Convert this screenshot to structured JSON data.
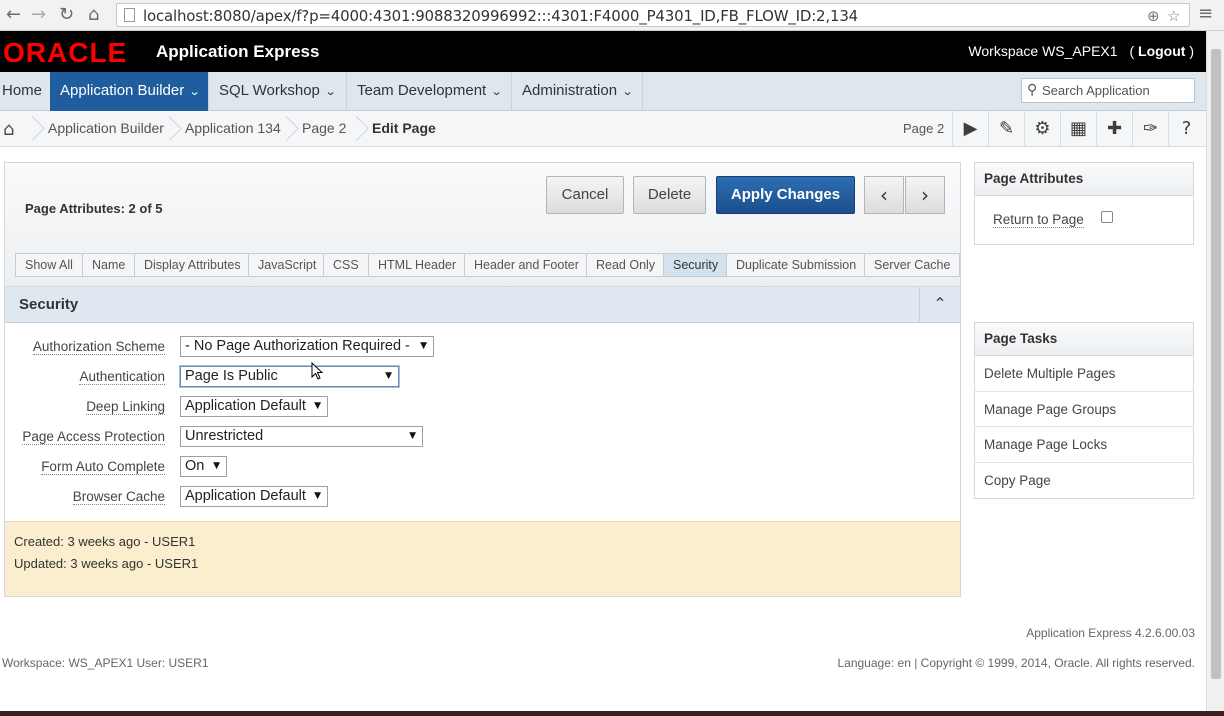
{
  "browser": {
    "url": "localhost:8080/apex/f?p=4000:4301:9088320996992:::4301:F4000_P4301_ID,FB_FLOW_ID:2,134"
  },
  "header": {
    "logo": "ORACLE",
    "product": "Application Express",
    "workspace_label": "Workspace WS_APEX1",
    "logout_open": "(",
    "logout": "Logout",
    "logout_close": ")"
  },
  "menu": {
    "items": [
      {
        "label": "Home"
      },
      {
        "label": "Application Builder"
      },
      {
        "label": "SQL Workshop"
      },
      {
        "label": "Team Development"
      },
      {
        "label": "Administration"
      }
    ],
    "search_placeholder": "Search Application"
  },
  "breadcrumb": {
    "items": [
      "Application Builder",
      "Application 134",
      "Page 2",
      "Edit Page"
    ],
    "page_indicator": "Page 2"
  },
  "region": {
    "title_label": "Page Attributes:",
    "title_count": "2 of 5",
    "buttons": {
      "cancel": "Cancel",
      "delete": "Delete",
      "apply": "Apply Changes"
    },
    "tabs": [
      "Show All",
      "Name",
      "Display Attributes",
      "JavaScript",
      "CSS",
      "HTML Header",
      "Header and Footer",
      "Read Only",
      "Security",
      "Duplicate Submission",
      "Server Cache"
    ],
    "active_tab": "Security",
    "section_title": "Security",
    "fields": [
      {
        "label": "Authorization Scheme",
        "value": "- No Page Authorization Required -"
      },
      {
        "label": "Authentication",
        "value": "Page Is Public"
      },
      {
        "label": "Deep Linking",
        "value": "Application Default"
      },
      {
        "label": "Page Access Protection",
        "value": "Unrestricted"
      },
      {
        "label": "Form Auto Complete",
        "value": "On"
      },
      {
        "label": "Browser Cache",
        "value": "Application Default"
      }
    ],
    "created": "Created: 3 weeks ago - USER1",
    "updated": "Updated: 3 weeks ago - USER1"
  },
  "sidebar": {
    "attributes_title": "Page Attributes",
    "return_to_page": "Return to Page",
    "tasks_title": "Page Tasks",
    "tasks": [
      "Delete Multiple Pages",
      "Manage Page Groups",
      "Manage Page Locks",
      "Copy Page"
    ]
  },
  "footer": {
    "version": "Application Express 4.2.6.00.03",
    "workspace_user": "Workspace: WS_APEX1 User: USER1",
    "copyright": "Language: en | Copyright © 1999, 2014, Oracle. All rights reserved."
  },
  "colors": {
    "brand_red": "#ff0000",
    "active_menu": "#1f5d9e",
    "primary_button": "#1c4f8c",
    "info_bg": "#faeecf"
  }
}
